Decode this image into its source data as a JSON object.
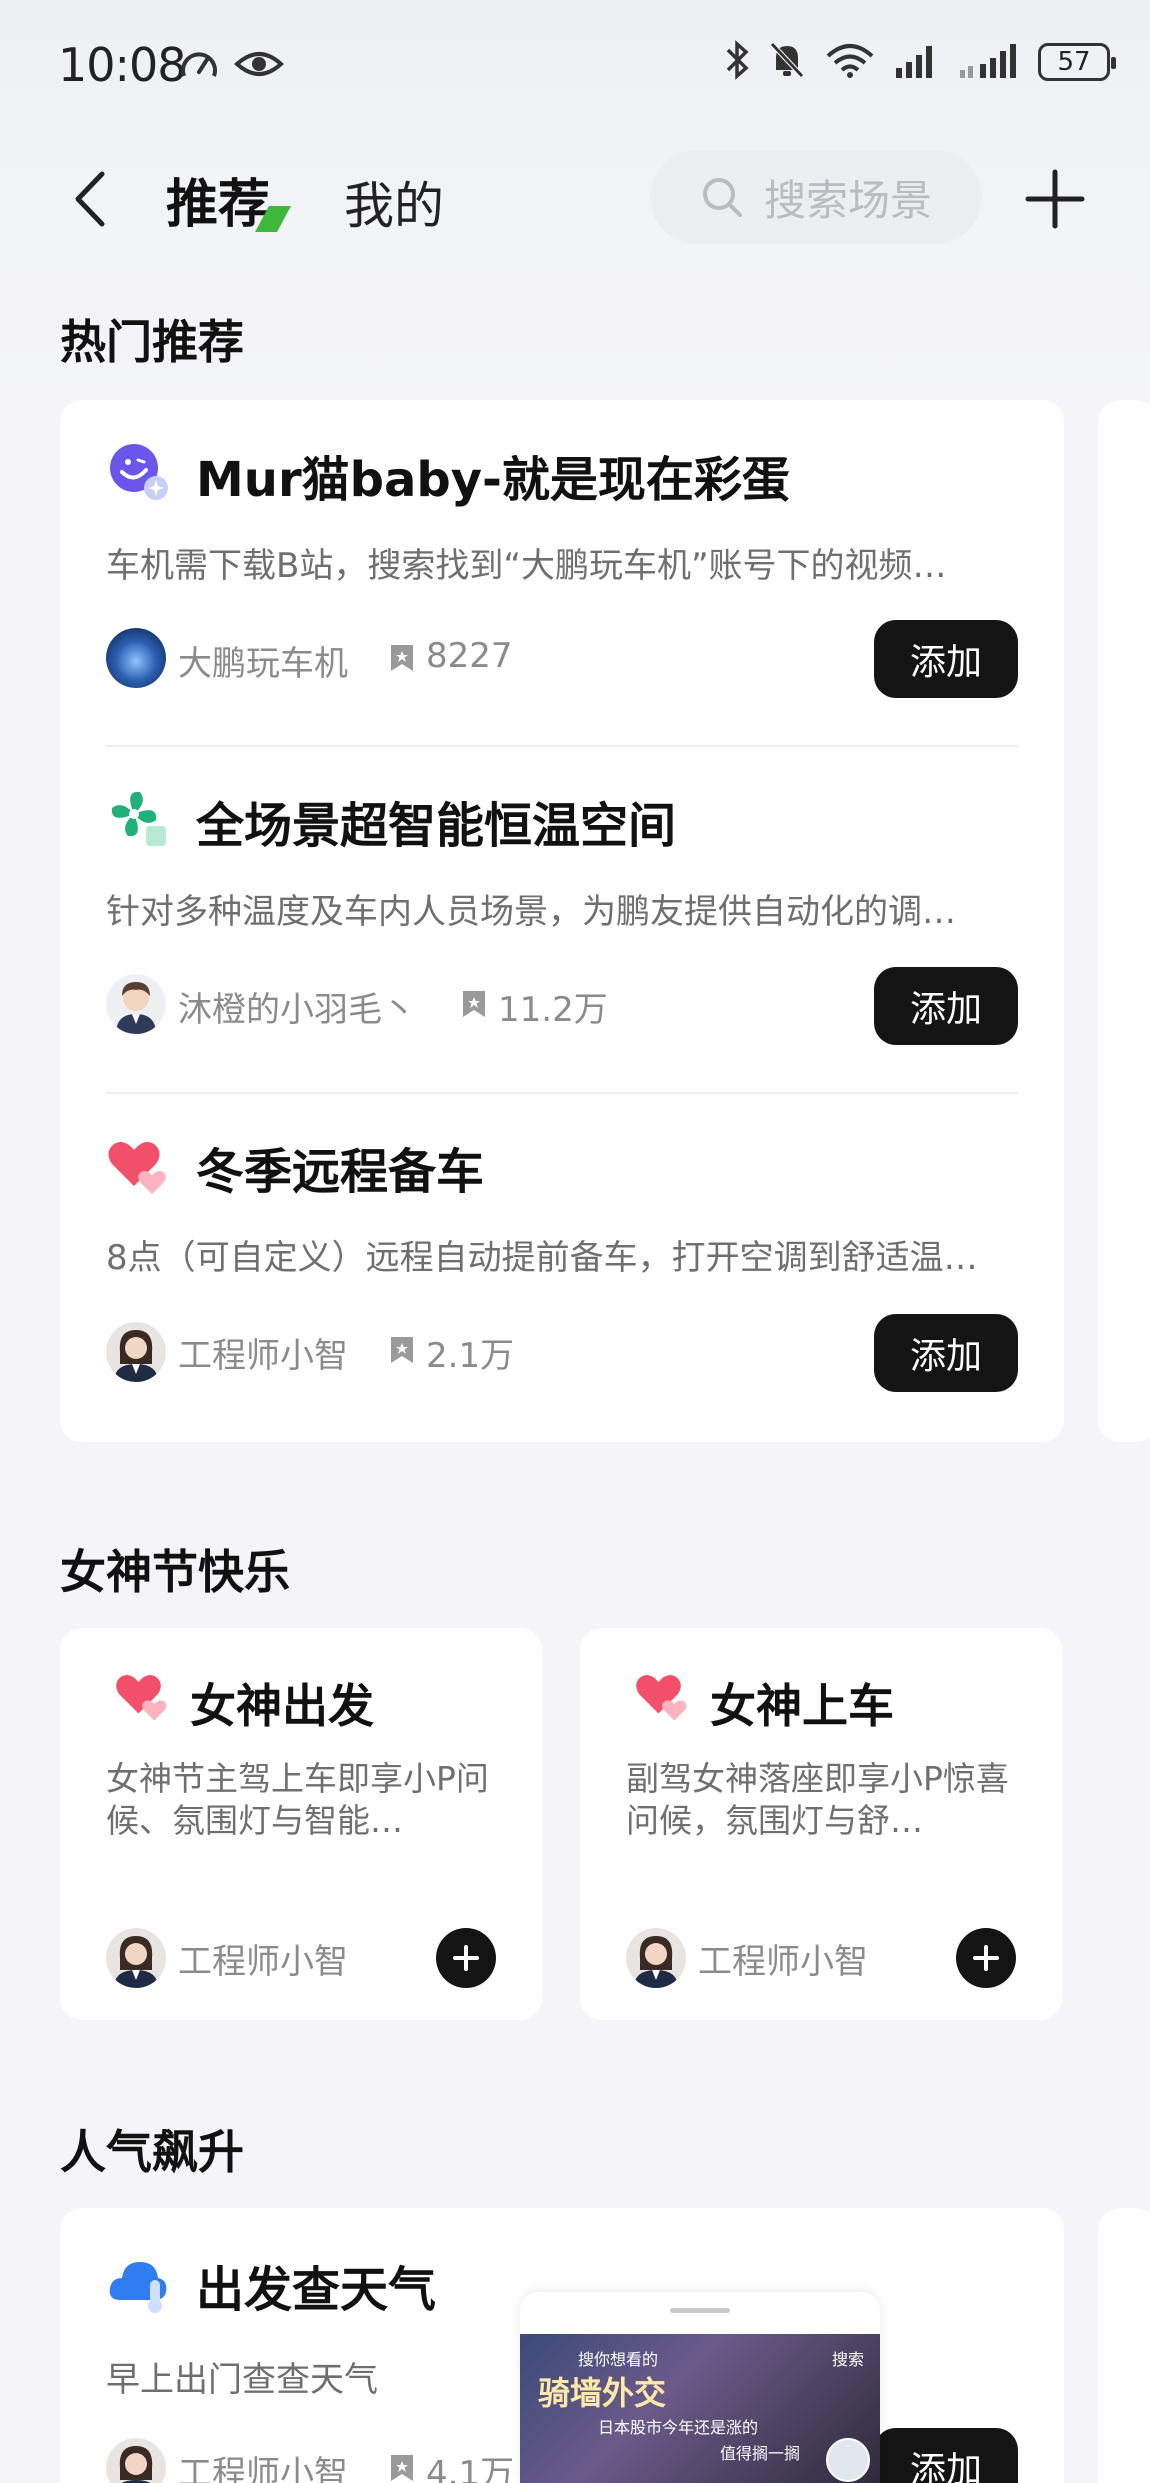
{
  "status_bar": {
    "time": "10:08",
    "battery": "57"
  },
  "nav": {
    "tabs": [
      "推荐",
      "我的"
    ],
    "search_placeholder": "搜索场景"
  },
  "sections": {
    "hot": "热门推荐",
    "goddess": "女神节快乐",
    "rising": "人气飙升"
  },
  "hot_items": [
    {
      "title": "Mur猫baby-就是现在彩蛋",
      "desc": "车机需下载B站，搜索找到“大鹏玩车机”账号下的视频…",
      "author": "大鹏玩车机",
      "favs": "8227",
      "button": "添加"
    },
    {
      "title": "全场景超智能恒温空间",
      "desc": "针对多种温度及车内人员场景，为鹏友提供自动化的调…",
      "author": "沐橙的小羽毛丶",
      "favs": "11.2万",
      "button": "添加"
    },
    {
      "title": "冬季远程备车",
      "desc": "8点（可自定义）远程自动提前备车，打开空调到舒适温…",
      "author": "工程师小智",
      "favs": "2.1万",
      "button": "添加"
    }
  ],
  "goddess_items": [
    {
      "title": "女神出发",
      "desc": "女神节主驾上车即享小P问候、氛围灯与智能…",
      "author": "工程师小智"
    },
    {
      "title": "女神上车",
      "desc": "副驾女神落座即享小P惊喜问候，氛围灯与舒…",
      "author": "工程师小智"
    }
  ],
  "rising_items": [
    {
      "title": "出发查天气",
      "desc": "早上出门查查天气",
      "author": "工程师小智",
      "favs": "4.1万",
      "button": "添加"
    }
  ],
  "floating_video": {
    "line1": "搜你想看的",
    "search": "搜索",
    "caption": "骑墙外交",
    "line2": "日本股市今年还是涨的",
    "line3": "值得搁一搁"
  }
}
